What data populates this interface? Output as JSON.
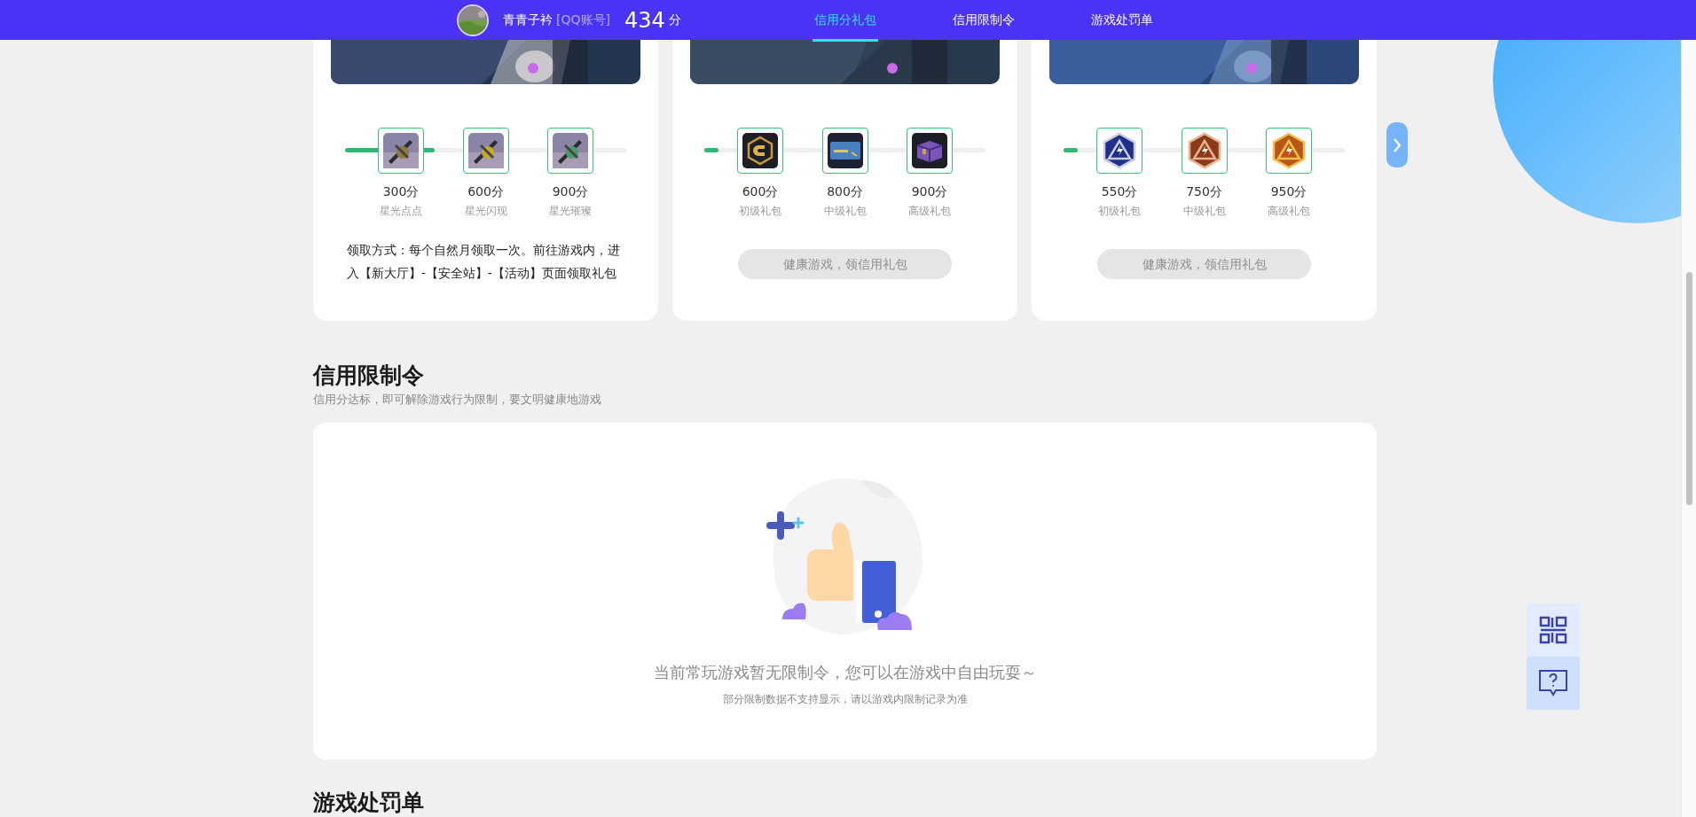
{
  "header": {
    "user": {
      "name": "青青子衿",
      "account_type": "[QQ账号]",
      "score": "434",
      "score_unit": "分"
    },
    "tabs": [
      {
        "label": "信用分礼包",
        "selected": true
      },
      {
        "label": "信用限制令",
        "selected": false
      },
      {
        "label": "游戏处罚单",
        "selected": false
      }
    ]
  },
  "gift_cards": [
    {
      "level": 0.32,
      "rewards": [
        {
          "points": "300分",
          "label": "星光点点"
        },
        {
          "points": "600分",
          "label": "星光闪现"
        },
        {
          "points": "900分",
          "label": "星光璀璨"
        }
      ],
      "description": "领取方式：每个自然月领取一次。前往游戏内，进入【新大厅】-【安全站】-【活动】页面领取礼包"
    },
    {
      "level": 0.05,
      "rewards": [
        {
          "points": "600分",
          "label": "初级礼包"
        },
        {
          "points": "800分",
          "label": "中级礼包"
        },
        {
          "points": "900分",
          "label": "高级礼包"
        }
      ],
      "button": {
        "label": "健康游戏，领信用礼包",
        "disabled": true
      }
    },
    {
      "level": 0.05,
      "rewards": [
        {
          "points": "550分",
          "label": "初级礼包"
        },
        {
          "points": "750分",
          "label": "中级礼包"
        },
        {
          "points": "950分",
          "label": "高级礼包"
        }
      ],
      "button": {
        "label": "健康游戏，领信用礼包",
        "disabled": true
      }
    }
  ],
  "restrictions": {
    "title": "信用限制令",
    "subtitle": "信用分达标，即可解除游戏行为限制，要文明健康地游戏",
    "empty_message": "当前常玩游戏暂无限制令，您可以在游戏中自由玩耍～",
    "note": "部分限制数据不支持显示，请以游戏内限制记录为准"
  },
  "penalties": {
    "title": "游戏处罚单"
  }
}
